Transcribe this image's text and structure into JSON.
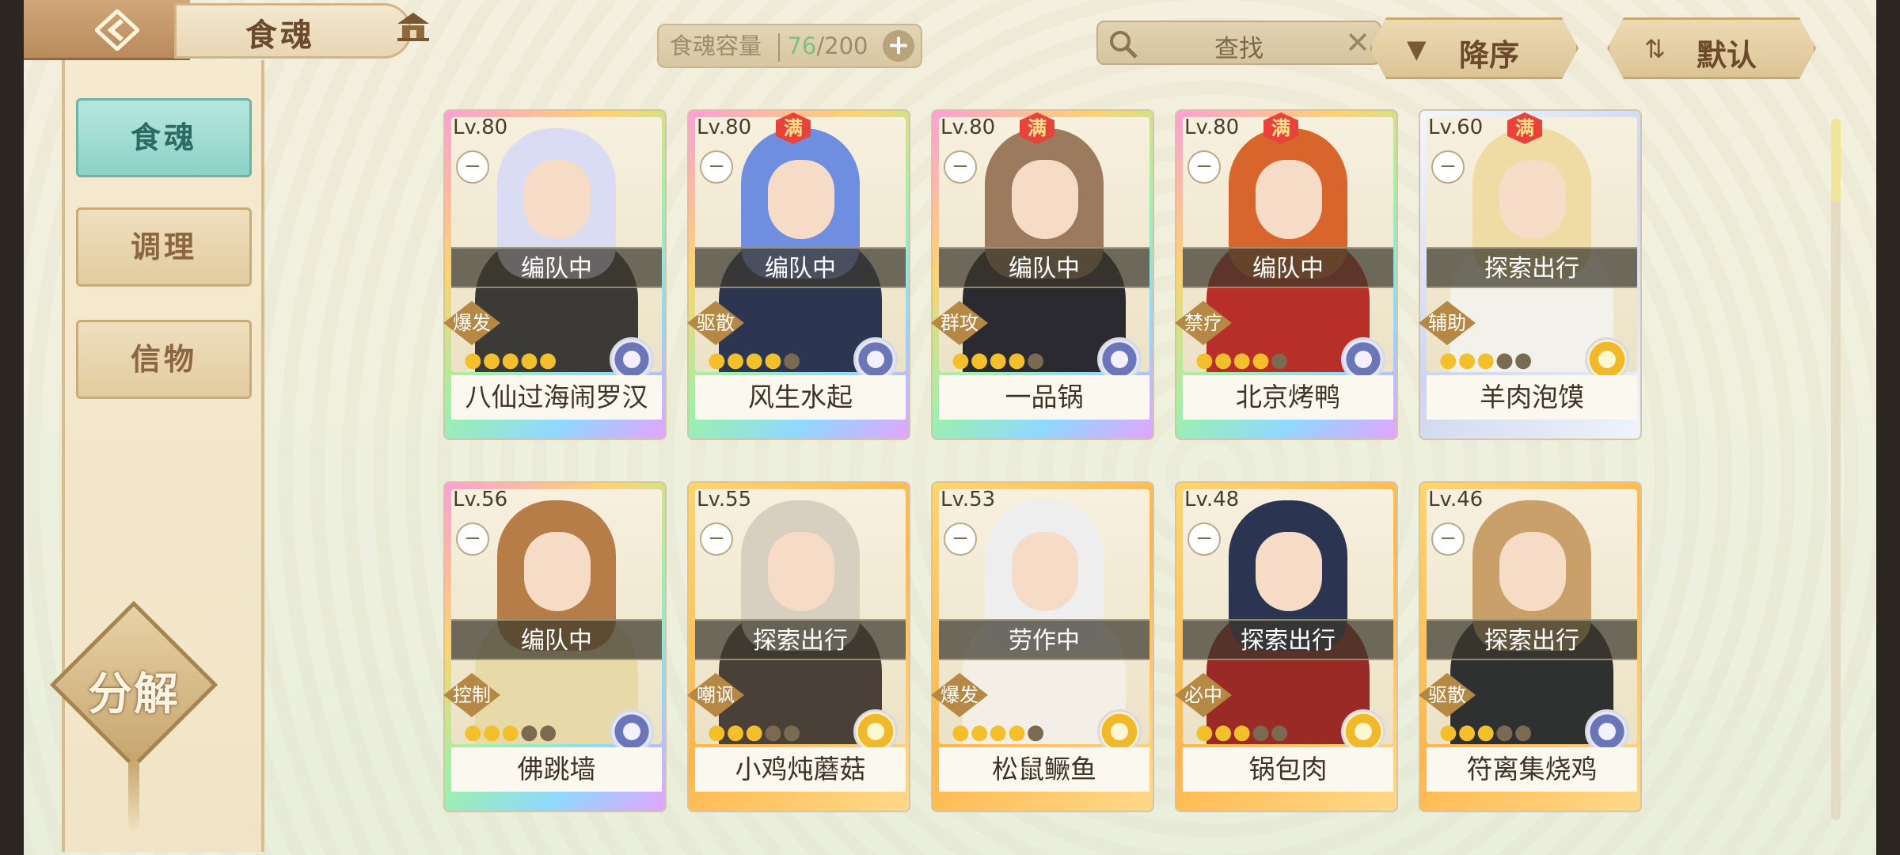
{
  "header": {
    "title": "食魂",
    "capacity_label": "食魂容量",
    "capacity_current": "76",
    "capacity_max": "/200",
    "capacity_add": "+",
    "search_placeholder": "查找",
    "search_clear": "✕",
    "sort_order_label": "降序",
    "sort_mode_label": "默认"
  },
  "sidebar": {
    "tabs": [
      {
        "label": "食魂",
        "active": true
      },
      {
        "label": "调理",
        "active": false
      },
      {
        "label": "信物",
        "active": false
      }
    ],
    "decompose_label": "分解"
  },
  "colors": {
    "flame_on": "#f3bf2b",
    "flame_off": "#7a6a52",
    "active_tab": "#8cd2c7"
  },
  "cards": [
    {
      "level": "Lv.80",
      "full": true,
      "full_label": "",
      "status": "编队中",
      "role": "爆发",
      "stars_on": 5,
      "stars_total": 5,
      "name": "八仙过海闹罗汉",
      "frame": "rainbow",
      "element": "blue"
    },
    {
      "level": "Lv.80",
      "full": true,
      "full_label": "满",
      "status": "编队中",
      "role": "驱散",
      "stars_on": 4,
      "stars_total": 5,
      "name": "风生水起",
      "frame": "rainbow",
      "element": "blue"
    },
    {
      "level": "Lv.80",
      "full": true,
      "full_label": "满",
      "status": "编队中",
      "role": "群攻",
      "stars_on": 4,
      "stars_total": 5,
      "name": "一品锅",
      "frame": "rainbow",
      "element": "blue"
    },
    {
      "level": "Lv.80",
      "full": true,
      "full_label": "满",
      "status": "编队中",
      "role": "禁疗",
      "stars_on": 4,
      "stars_total": 5,
      "name": "北京烤鸭",
      "frame": "rainbow",
      "element": "blue"
    },
    {
      "level": "Lv.60",
      "full": true,
      "full_label": "满",
      "status": "探索出行",
      "role": "辅助",
      "stars_on": 3,
      "stars_total": 5,
      "name": "羊肉泡馍",
      "frame": "silver",
      "element": "gold"
    },
    {
      "level": "Lv.56",
      "full": false,
      "full_label": "",
      "status": "编队中",
      "role": "控制",
      "stars_on": 3,
      "stars_total": 5,
      "name": "佛跳墙",
      "frame": "rainbow",
      "element": "blue"
    },
    {
      "level": "Lv.55",
      "full": false,
      "full_label": "",
      "status": "探索出行",
      "role": "嘲讽",
      "stars_on": 3,
      "stars_total": 5,
      "name": "小鸡炖蘑菇",
      "frame": "gold",
      "element": "gold"
    },
    {
      "level": "Lv.53",
      "full": false,
      "full_label": "",
      "status": "劳作中",
      "role": "爆发",
      "stars_on": 4,
      "stars_total": 5,
      "name": "松鼠鳜鱼",
      "frame": "gold",
      "element": "gold"
    },
    {
      "level": "Lv.48",
      "full": false,
      "full_label": "",
      "status": "探索出行",
      "role": "必中",
      "stars_on": 3,
      "stars_total": 5,
      "name": "锅包肉",
      "frame": "gold",
      "element": "gold"
    },
    {
      "level": "Lv.46",
      "full": false,
      "full_label": "",
      "status": "探索出行",
      "role": "驱散",
      "stars_on": 3,
      "stars_total": 5,
      "name": "符离集烧鸡",
      "frame": "gold",
      "element": "blue"
    }
  ]
}
